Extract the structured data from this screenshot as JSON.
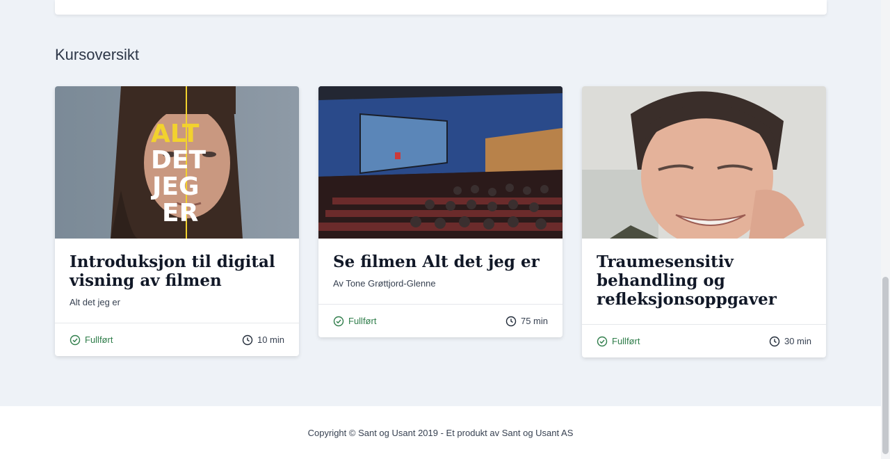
{
  "section": {
    "title": "Kursoversikt"
  },
  "cards": [
    {
      "title": "Introduksjon til digital visning av filmen",
      "subtitle": "Alt det jeg er",
      "status": "Fullført",
      "duration": "10 min",
      "image_alt": "portrait-with-title-poster",
      "poster_text": [
        "ALT",
        "DET",
        "JEG",
        "ER"
      ]
    },
    {
      "title": "Se filmen Alt det jeg er",
      "subtitle": "Av Tone Grøttjord-Glenne",
      "status": "Fullført",
      "duration": "75 min",
      "image_alt": "cinema-audience-screen"
    },
    {
      "title": "Traumesensitiv behandling og refleksjonsoppgaver",
      "subtitle": "",
      "status": "Fullført",
      "duration": "30 min",
      "image_alt": "smiling-woman-portrait"
    }
  ],
  "footer": {
    "copyright": "Copyright © Sant og Usant 2019 - Et produkt av Sant og Usant AS"
  },
  "colors": {
    "background": "#eef2f7",
    "status_green": "#2f7d4a",
    "poster_yellow": "#f2d22e"
  }
}
